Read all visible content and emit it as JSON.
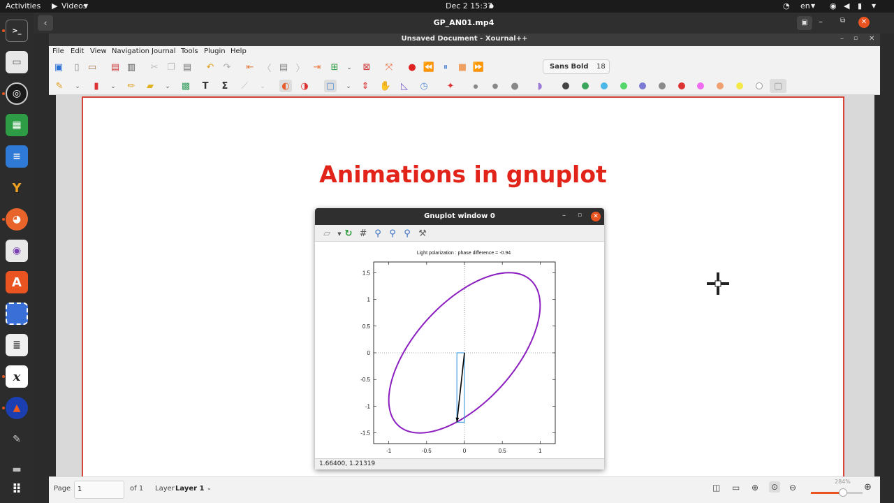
{
  "topbar": {
    "activities": "Activities",
    "app_menu": "Videos",
    "datetime": "Dec 2  15:37",
    "language": "en"
  },
  "video_player": {
    "title": "GP_AN01.mp4"
  },
  "xournal": {
    "window_title": "Unsaved Document - Xournal++",
    "menu": [
      "File",
      "Edit",
      "View",
      "Navigation",
      "Journal",
      "Tools",
      "Plugin",
      "Help"
    ],
    "font_name": "Sans Bold",
    "font_size": "18",
    "palette": [
      "#444444",
      "#3ba55c",
      "#4db8e8",
      "#55d66b",
      "#7b7bd4",
      "#8a8a8a",
      "#f06cf0",
      "#f0a070",
      "#f5e84a",
      "#ffffff"
    ],
    "accent": "#e2231a"
  },
  "page": {
    "title": "Animations in gnuplot"
  },
  "gnuplot": {
    "window_title": "Gnuplot window 0",
    "status": "1.66400,  1.21319"
  },
  "chart_data": {
    "type": "line",
    "title": "Light polarization : phase difference = -0.94",
    "xlim": [
      -1.2,
      1.2
    ],
    "ylim": [
      -1.7,
      1.7
    ],
    "xticks": [
      "-1",
      "-0.5",
      "0",
      "0.5",
      "1"
    ],
    "yticks": [
      "1.5",
      "1",
      "0.5",
      "0",
      "-0.5",
      "-1",
      "-1.5"
    ],
    "series": [
      {
        "color": "#8b1fbf",
        "style": "ellipse",
        "x_amplitude": 1.0,
        "y_amplitude": 1.5,
        "phase_difference": -0.94
      }
    ],
    "vector": {
      "x": [
        0,
        -0.1
      ],
      "y": [
        0,
        -1.3
      ],
      "color": "#000000"
    },
    "components_box": {
      "x": [
        -0.1,
        0
      ],
      "y": [
        -1.3,
        0
      ],
      "color": "#4aa3df"
    },
    "zero_lines": true
  },
  "statusbar": {
    "page_label": "Page",
    "page_value": "1",
    "of_label": "of 1",
    "layer_label": "Layer",
    "layer_value": "Layer 1",
    "zoom": "284%"
  }
}
